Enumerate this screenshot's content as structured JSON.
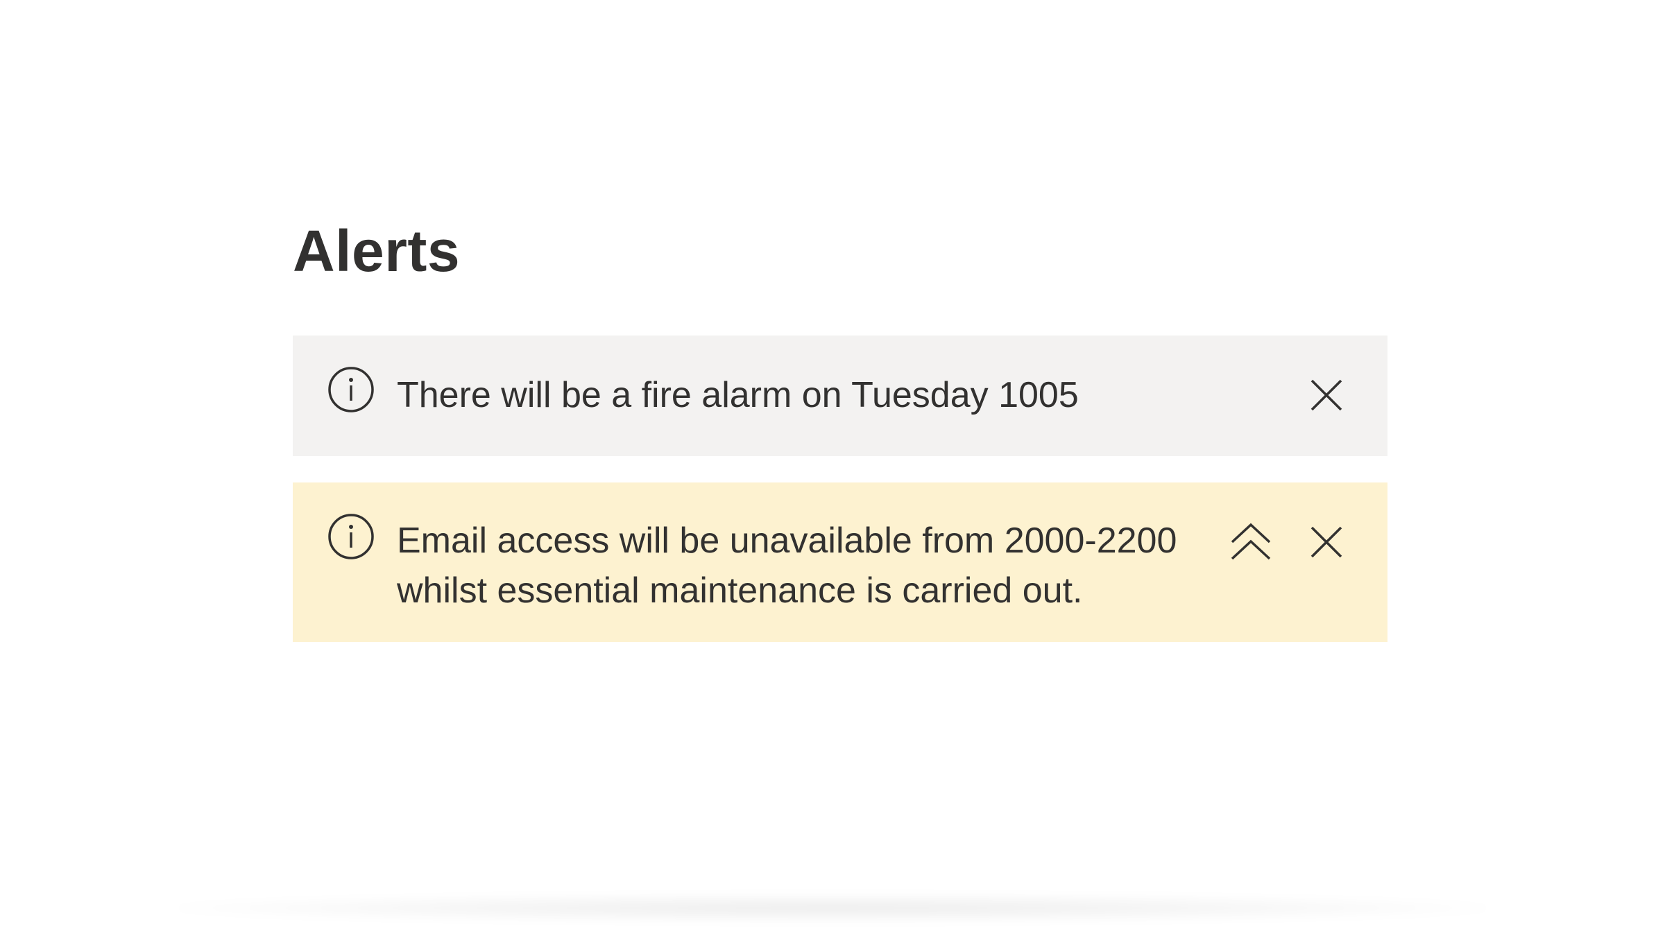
{
  "page": {
    "title": "Alerts"
  },
  "alerts": [
    {
      "severity": "info",
      "icon": "info-circle-icon",
      "message": "There will be a fire alarm on Tuesday 1005",
      "background": "#f3f2f1",
      "actions": [
        "close-icon"
      ]
    },
    {
      "severity": "warning",
      "icon": "info-circle-icon",
      "message": "Email access will be unavailable from 2000-2200 whilst essential maintenance is carried out.",
      "background": "#fdf2d0",
      "actions": [
        "double-chevron-up-icon",
        "close-icon"
      ]
    }
  ],
  "colors": {
    "text": "#323130",
    "info_bg": "#f3f2f1",
    "warning_bg": "#fdf2d0"
  }
}
